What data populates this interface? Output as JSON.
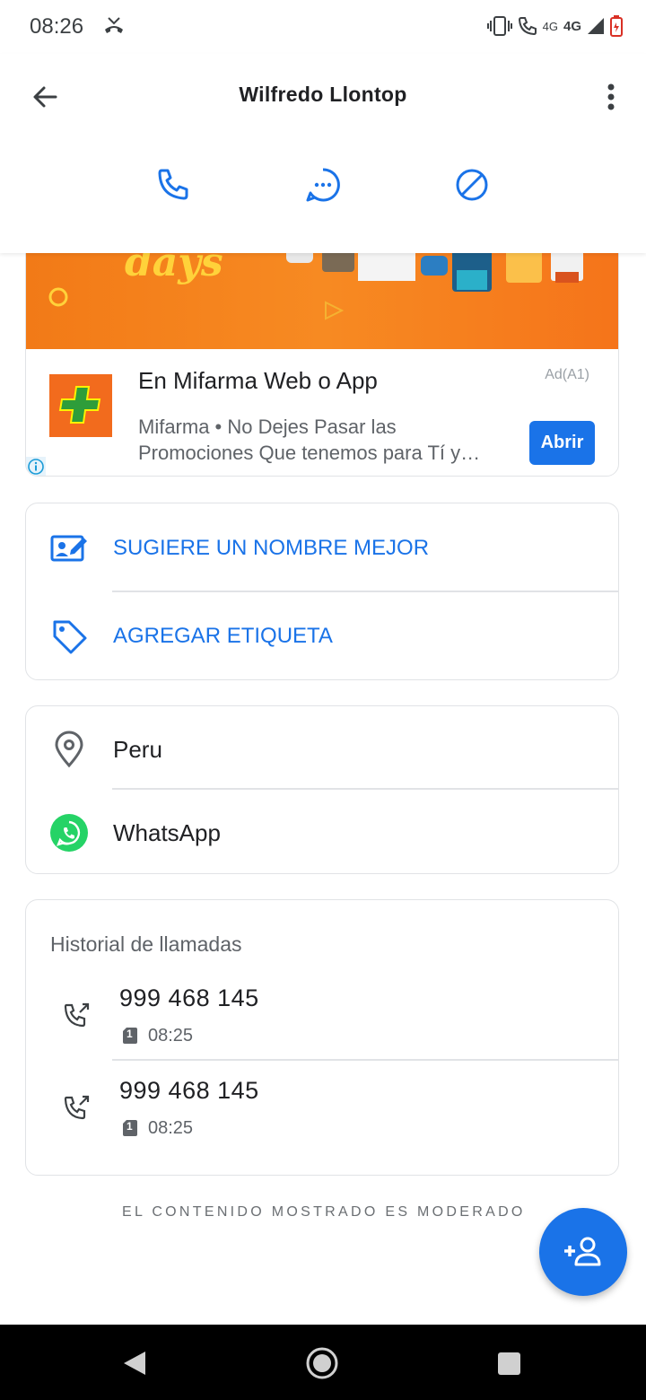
{
  "status_bar": {
    "time": "08:26",
    "network_1": "4G",
    "network_2": "4G"
  },
  "header": {
    "title": "Wilfredo Llontop",
    "actions": [
      "phone-icon",
      "message-icon",
      "block-icon"
    ]
  },
  "ad": {
    "banner_text": "days",
    "title": "En Mifarma Web o App",
    "tag": "Ad(A1)",
    "description_line1": "Mifarma • No Dejes Pasar las",
    "description_line2": "Promociones Que tenemos para Tí y…",
    "cta": "Abrir"
  },
  "actions_card": {
    "suggest_name": "SUGIERE UN NOMBRE MEJOR",
    "add_tag": "AGREGAR ETIQUETA"
  },
  "info_card": {
    "location": "Peru",
    "app": "WhatsApp"
  },
  "call_history": {
    "title": "Historial de llamadas",
    "calls": [
      {
        "number": "999 468 145",
        "sim": "1",
        "time": "08:25"
      },
      {
        "number": "999 468 145",
        "sim": "1",
        "time": "08:25"
      }
    ]
  },
  "footer": {
    "note": "EL CONTENIDO MOSTRADO ES MODERADO"
  },
  "colors": {
    "accent": "#1a73e8",
    "whatsapp": "#25d366",
    "ad_orange": "#f47c1c"
  }
}
